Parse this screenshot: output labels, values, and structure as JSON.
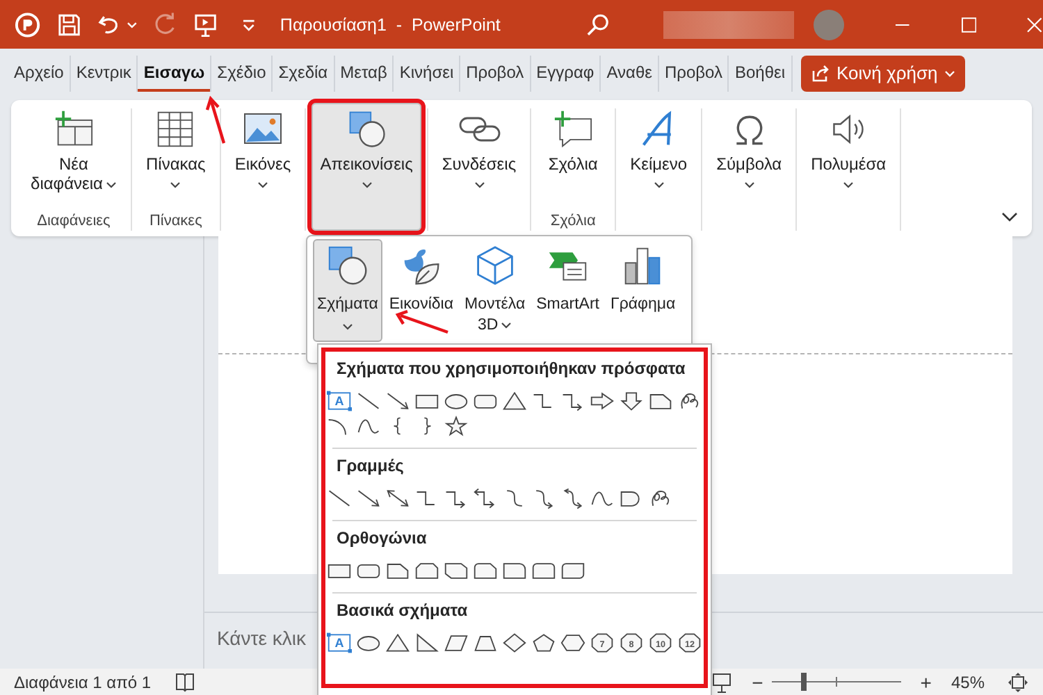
{
  "title_bar": {
    "title": "Παρουσίαση1  -  PowerPoint",
    "redo_disabled": true
  },
  "tabs": [
    {
      "label": "Αρχείο",
      "selected": false
    },
    {
      "label": "Κεντρικ",
      "selected": false
    },
    {
      "label": "Εισαγω",
      "selected": true
    },
    {
      "label": "Σχέδιο",
      "selected": false
    },
    {
      "label": "Σχεδία",
      "selected": false
    },
    {
      "label": "Μεταβ",
      "selected": false
    },
    {
      "label": "Κινήσει",
      "selected": false
    },
    {
      "label": "Προβολ",
      "selected": false
    },
    {
      "label": "Εγγραφ",
      "selected": false
    },
    {
      "label": "Αναθε",
      "selected": false
    },
    {
      "label": "Προβολ",
      "selected": false
    },
    {
      "label": "Βοήθει",
      "selected": false
    }
  ],
  "share_button": {
    "label": "Κοινή χρήση"
  },
  "ribbon_groups": [
    {
      "label": "Διαφάνειες",
      "buttons": [
        {
          "label": "Νέα διαφάνεια",
          "dropdown": true,
          "selected": false,
          "highlighted": false
        }
      ]
    },
    {
      "label": "Πίνακες",
      "buttons": [
        {
          "label": "Πίνακας",
          "dropdown": true,
          "selected": false,
          "highlighted": false
        }
      ]
    },
    {
      "buttons": [
        {
          "label": "Εικόνες",
          "dropdown": true,
          "selected": false,
          "highlighted": false
        }
      ]
    },
    {
      "buttons": [
        {
          "label": "Απεικονίσεις",
          "dropdown": true,
          "selected": true,
          "highlighted": true
        }
      ]
    },
    {
      "buttons": [
        {
          "label": "Συνδέσεις",
          "dropdown": true,
          "selected": false,
          "highlighted": false
        }
      ]
    },
    {
      "label": "Σχόλια",
      "buttons": [
        {
          "label": "Σχόλια",
          "dropdown": false,
          "selected": false,
          "highlighted": false
        }
      ]
    },
    {
      "buttons": [
        {
          "label": "Κείμενο",
          "dropdown": true,
          "selected": false,
          "highlighted": false
        }
      ]
    },
    {
      "buttons": [
        {
          "label": "Σύμβολα",
          "dropdown": true,
          "selected": false,
          "highlighted": false
        }
      ]
    },
    {
      "buttons": [
        {
          "label": "Πολυμέσα",
          "dropdown": true,
          "selected": false,
          "highlighted": false
        }
      ]
    }
  ],
  "illustrations_menu": [
    {
      "label": "Σχήματα",
      "dropdown": true,
      "selected": true
    },
    {
      "label": "Εικονίδια",
      "dropdown": false,
      "selected": false
    },
    {
      "label": "Μοντέλα",
      "sub": "3D",
      "dropdown": true,
      "selected": false
    },
    {
      "label": "SmartArt",
      "dropdown": false,
      "selected": false
    },
    {
      "label": "Γράφημα",
      "dropdown": false,
      "selected": false
    }
  ],
  "shapes_gallery": {
    "highlighted": true,
    "sections": [
      {
        "title": "Σχήματα που χρησιμοποιήθηκαν πρόσφατα",
        "shapes": [
          {
            "kind": "textbox",
            "label": "A"
          },
          {
            "kind": "line"
          },
          {
            "kind": "arrow-line"
          },
          {
            "kind": "rectangle"
          },
          {
            "kind": "ellipse"
          },
          {
            "kind": "rounded-rectangle"
          },
          {
            "kind": "triangle"
          },
          {
            "kind": "elbow-connector"
          },
          {
            "kind": "elbow-arrow-connector"
          },
          {
            "kind": "right-arrow"
          },
          {
            "kind": "down-arrow"
          },
          {
            "kind": "snip-corner"
          },
          {
            "kind": "scribble"
          },
          {
            "kind": "arc"
          },
          {
            "kind": "curve"
          },
          {
            "kind": "left-brace"
          },
          {
            "kind": "right-brace"
          },
          {
            "kind": "star"
          }
        ]
      },
      {
        "title": "Γραμμές",
        "shapes": [
          {
            "kind": "line"
          },
          {
            "kind": "arrow-line"
          },
          {
            "kind": "double-arrow-line"
          },
          {
            "kind": "elbow-connector"
          },
          {
            "kind": "elbow-arrow-connector"
          },
          {
            "kind": "elbow-double-arrow"
          },
          {
            "kind": "curved-connector"
          },
          {
            "kind": "curved-arrow-connector"
          },
          {
            "kind": "curved-double-arrow"
          },
          {
            "kind": "curve"
          },
          {
            "kind": "freeform-shape"
          },
          {
            "kind": "scribble"
          }
        ]
      },
      {
        "title": "Ορθογώνια",
        "shapes": [
          {
            "kind": "rectangle"
          },
          {
            "kind": "rounded-rectangle"
          },
          {
            "kind": "snip-corner"
          },
          {
            "kind": "snip-same"
          },
          {
            "kind": "snip-diagonal"
          },
          {
            "kind": "snip-round"
          },
          {
            "kind": "round-single"
          },
          {
            "kind": "round-same"
          },
          {
            "kind": "round-diagonal"
          }
        ]
      },
      {
        "title": "Βασικά σχήματα",
        "shapes": [
          {
            "kind": "textbox",
            "label": "A"
          },
          {
            "kind": "ellipse"
          },
          {
            "kind": "triangle"
          },
          {
            "kind": "right-triangle"
          },
          {
            "kind": "parallelogram"
          },
          {
            "kind": "trapezoid"
          },
          {
            "kind": "diamond"
          },
          {
            "kind": "pentagon"
          },
          {
            "kind": "hexagon"
          },
          {
            "kind": "numbered-polygon",
            "label": "7"
          },
          {
            "kind": "numbered-polygon",
            "label": "8"
          },
          {
            "kind": "numbered-polygon",
            "label": "10"
          },
          {
            "kind": "numbered-polygon",
            "label": "12"
          }
        ]
      }
    ]
  },
  "notes": {
    "placeholder": "Κάντε κλικ"
  },
  "status_bar": {
    "slide_counter": "Διαφάνεια 1 από 1",
    "zoom_out": "−",
    "zoom_in": "+",
    "zoom": "45%",
    "zoom_slider": {
      "level": 0.25
    }
  }
}
